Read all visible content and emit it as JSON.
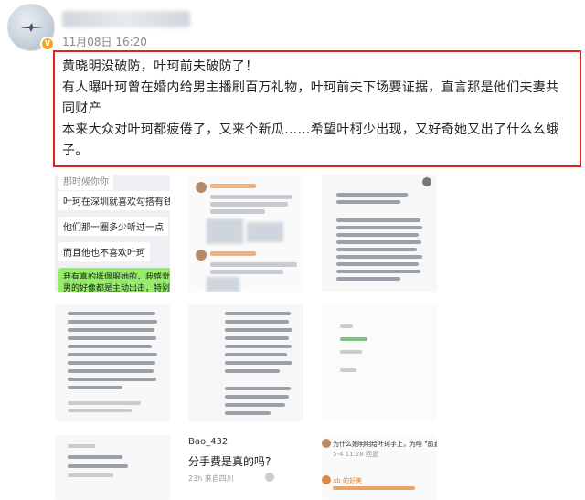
{
  "post": {
    "time": "11月08日 16:20",
    "verified_badge": "V",
    "lines": [
      "黄晓明没破防，叶珂前夫破防了！",
      "有人曝叶珂曾在婚内给男主播刷百万礼物，叶珂前夫下场要证据，直言那是他们夫妻共",
      "同财产",
      "本来大众对叶珂都疲倦了，又来个新瓜……希望叶柯少出现，又好奇她又出了什么幺蛾",
      "子。"
    ]
  },
  "images": {
    "chat": {
      "partial_top": "那时候你你",
      "messages": [
        "叶珂在深圳就喜欢勾搭有钱人",
        "他们那一圈多少听过一点",
        "而且他也不喜欢叶珂",
        "我有真的挺佩服她的，我感觉她对",
        "男的好像都是主动出击，特别主"
      ]
    },
    "bottom_tile": {
      "name": "Bao_432",
      "question": "分手费是真的吗?",
      "meta": "23h 来自四川"
    },
    "comment_tile": {
      "line1": "为什么她明明给叶珂手上，为啥 \"前直接转账",
      "line2": "5-4 11:28 回复",
      "name2": "ab 的好美"
    }
  },
  "colors": {
    "highlight_border": "#e0241e",
    "wechat_green": "#95ec69",
    "vip_badge": "#f5a623"
  }
}
